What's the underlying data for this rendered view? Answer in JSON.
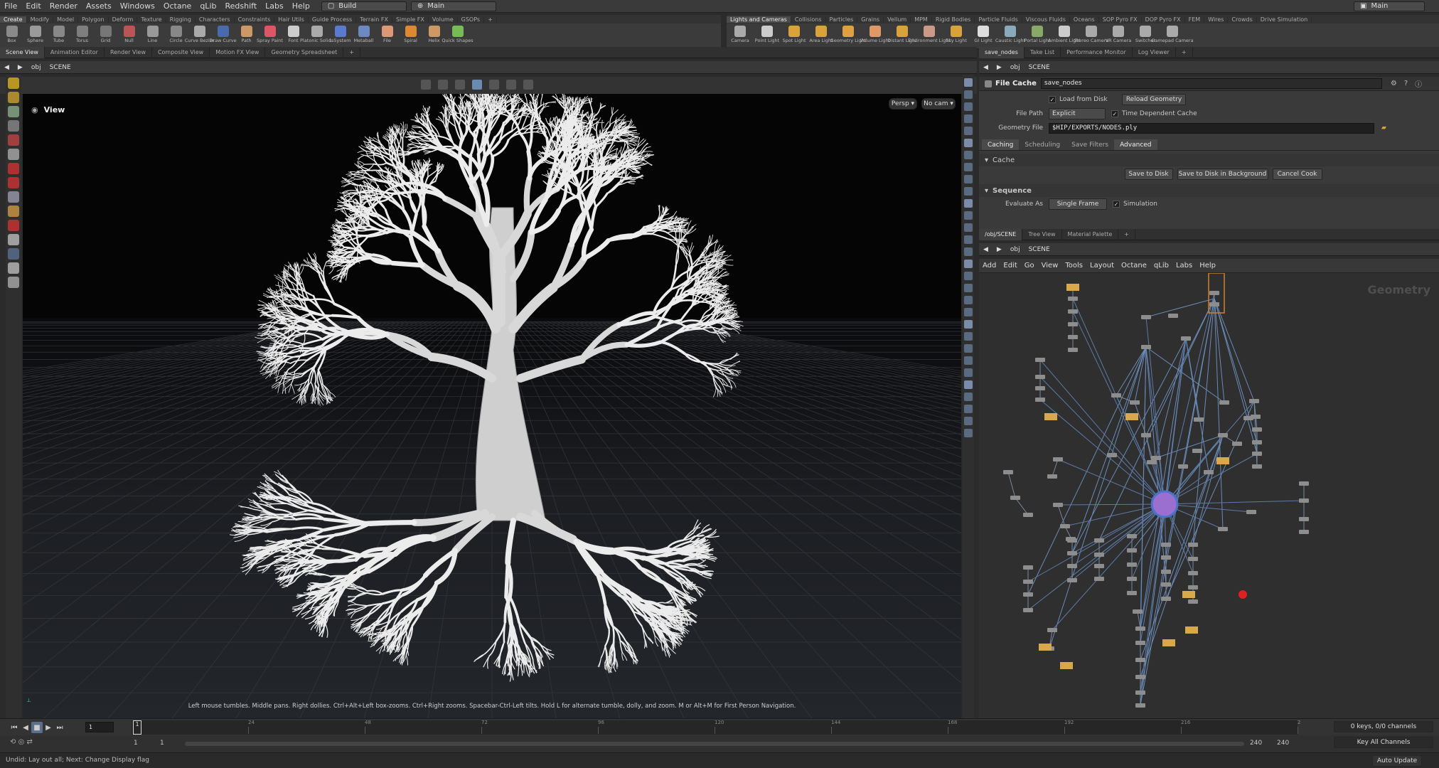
{
  "menu": [
    "File",
    "Edit",
    "Render",
    "Assets",
    "Windows",
    "Octane",
    "qLib",
    "Redshift",
    "Labs",
    "Help"
  ],
  "desktops": {
    "left": "Build",
    "right": "Main",
    "far_right": "Main"
  },
  "shelf_left_tabs": [
    "Create",
    "Modify",
    "Model",
    "Polygon",
    "Deform",
    "Texture",
    "Rigging",
    "Characters",
    "Constraints",
    "Hair Utils",
    "Guide Process",
    "Terrain FX",
    "Simple FX",
    "Volume",
    "GSOPs"
  ],
  "shelf_right_tabs": [
    "Lights and Cameras",
    "Collisions",
    "Particles",
    "Grains",
    "Vellum",
    "MPM",
    "Rigid Bodies",
    "Particle Fluids",
    "Viscous Fluids",
    "Oceans",
    "SOP Pyro FX",
    "DOP Pyro FX",
    "FEM",
    "Wires",
    "Crowds",
    "Drive Simulation"
  ],
  "tools_left": [
    "Box",
    "Sphere",
    "Tube",
    "Torus",
    "Grid",
    "Null",
    "Line",
    "Circle",
    "Curve Bezier",
    "Draw Curve",
    "Path",
    "Spray Paint",
    "Font",
    "Platonic Solids",
    "L-System",
    "Metaball",
    "File",
    "Spiral",
    "Helix",
    "Quick Shapes"
  ],
  "tools_right": [
    "Camera",
    "Point Light",
    "Spot Light",
    "Area Light",
    "Geometry Light",
    "Volume Light",
    "Distant Light",
    "Environment Light",
    "Sky Light",
    "GI Light",
    "Caustic Light",
    "Portal Light",
    "Ambient Light",
    "Stereo Camera",
    "VR Camera",
    "Switcher",
    "Gamepad Camera"
  ],
  "viewer_tabs": [
    "Scene View",
    "Animation Editor",
    "Render View",
    "Composite View",
    "Motion FX View",
    "Geometry Spreadsheet"
  ],
  "param_tabs": [
    "save_nodes",
    "Take List",
    "Performance Monitor",
    "Log Viewer"
  ],
  "network_tabs": [
    "/obj/SCENE",
    "Tree View",
    "Material Palette"
  ],
  "path": {
    "obj": "obj",
    "scene": "SCENE"
  },
  "viewport": {
    "label": "View",
    "persp": "Persp",
    "cam": "No cam",
    "hint": "Left mouse tumbles. Middle pans. Right dollies. Ctrl+Alt+Left box-zooms. Ctrl+Right zooms. Spacebar-Ctrl-Left tilts. Hold L for alternate tumble, dolly, and zoom. M or Alt+M for First Person Navigation."
  },
  "params": {
    "node_type": "File Cache",
    "node_name": "save_nodes",
    "load_from_disk": "Load from Disk",
    "reload": "Reload Geometry",
    "file_path_label": "File Path",
    "file_path_mode": "Explicit",
    "time_dep": "Time Dependent Cache",
    "geo_file_label": "Geometry File",
    "geo_file": "$HIP/EXPORTS/NODES.ply",
    "subtabs": [
      "Caching",
      "Scheduling",
      "Save Filters",
      "Advanced"
    ],
    "cache_section": "Cache",
    "save_to_disk": "Save to Disk",
    "save_bg": "Save to Disk in Background",
    "cancel": "Cancel Cook",
    "sequence_section": "Sequence",
    "evaluate_label": "Evaluate As",
    "evaluate_value": "Single Frame",
    "simulation": "Simulation"
  },
  "network_menu": [
    "Add",
    "Edit",
    "Go",
    "View",
    "Tools",
    "Layout",
    "Octane",
    "qLib",
    "Labs",
    "Help"
  ],
  "network_watermark": "Geometry",
  "timeline": {
    "frame": "1",
    "ticks": [
      "24",
      "48",
      "72",
      "96",
      "120",
      "144",
      "168",
      "192",
      "216",
      "2"
    ],
    "start": "1",
    "start2": "1",
    "end": "240",
    "end2": "240",
    "keys": "0 keys, 0/0 channels",
    "key_all": "Key All Channels",
    "auto_update": "Auto Update"
  },
  "status": "Undid: Lay out all; Next: Change Display flag"
}
